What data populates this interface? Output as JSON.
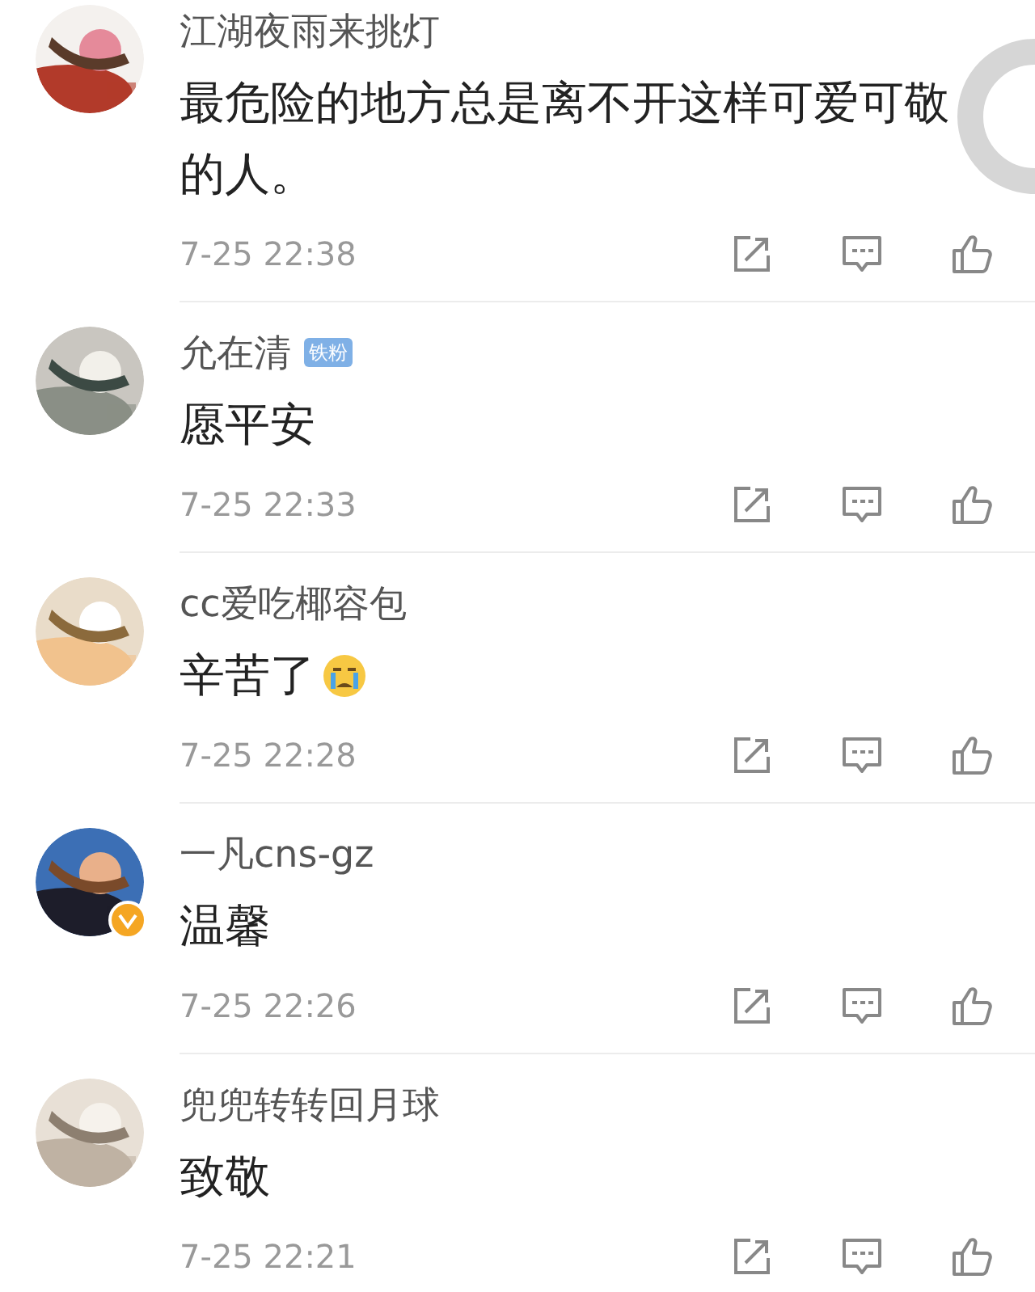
{
  "comments": [
    {
      "user": "江湖夜雨来挑灯",
      "verified": false,
      "text": "最危险的地方总是离不开这样可爱可敬的人。",
      "time": "7-25 22:38"
    },
    {
      "user": "允在清",
      "badge": "铁粉",
      "verified": false,
      "text": "愿平安",
      "time": "7-25 22:33"
    },
    {
      "user": "cc爱吃椰容包",
      "verified": false,
      "text": "辛苦了",
      "emoji": {
        "kind": "cry"
      },
      "time": "7-25 22:28"
    },
    {
      "user": "一凡cns-gz",
      "verified": true,
      "text": "温馨",
      "time": "7-25 22:26"
    },
    {
      "user": "兜兜转转回月球",
      "verified": false,
      "text": "致敬",
      "time": "7-25 22:21"
    }
  ]
}
